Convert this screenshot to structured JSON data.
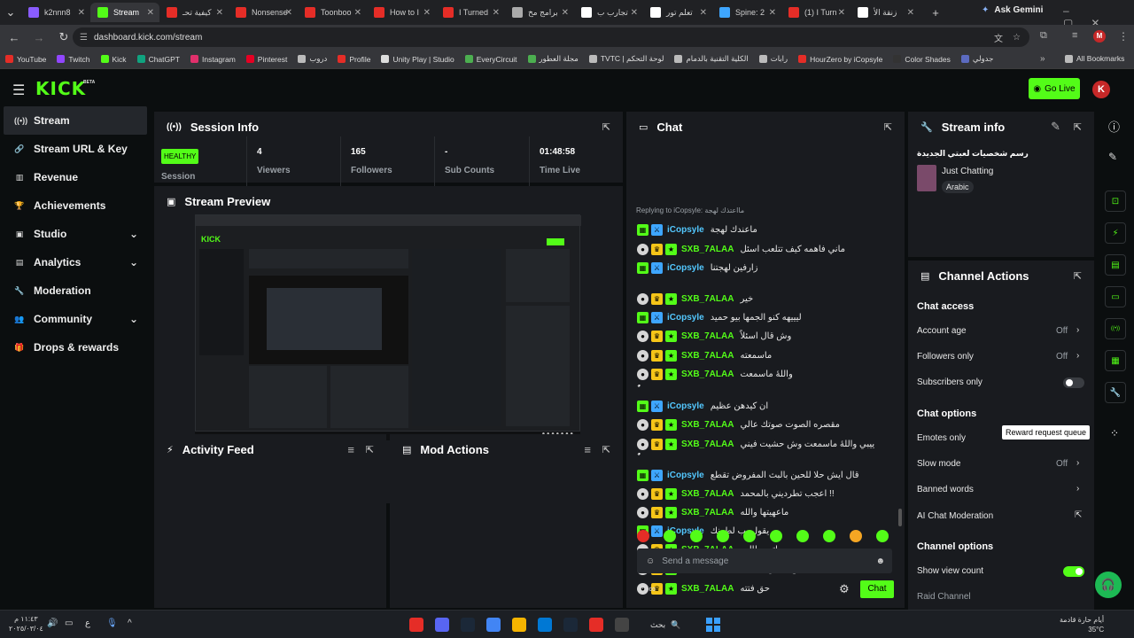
{
  "browser": {
    "tabs": [
      "k2nnn8",
      "Stream",
      "كيفية تحـ",
      "Nonsense",
      "Toonboo",
      "How to I",
      "I Turned",
      "برامج مخ",
      "تجارب ب",
      "تعلم تور",
      "Spine: 2",
      "(1) I Turn",
      "زنقة الأ"
    ],
    "active_tab": 1,
    "ask_gemini": "Ask Gemini",
    "url": "dashboard.kick.com/stream",
    "bookmarks": [
      "YouTube",
      "Twitch",
      "Kick",
      "ChatGPT",
      "Instagram",
      "Pinterest",
      "دروب",
      "Profile",
      "Unity Play | Studio",
      "EveryCircuit",
      "مجلة العطور",
      "TVTC | لوحة التحكم",
      "الكلية التقنية بالدمام",
      "رابات",
      "HourZero by iCopsyle",
      "Color Shades",
      "جدولي"
    ],
    "all_bookmarks": "All Bookmarks"
  },
  "app": {
    "logo": "KICK",
    "logo_badge": "BETA",
    "go_live": "Go Live",
    "avatar_letter": "K"
  },
  "sidebar": [
    {
      "label": "Stream",
      "icon": "stream-icon",
      "glyph": "((•))",
      "chevron": false
    },
    {
      "label": "Stream URL & Key",
      "icon": "link-icon",
      "glyph": "🔗",
      "chevron": false
    },
    {
      "label": "Revenue",
      "icon": "revenue-icon",
      "glyph": "▥",
      "chevron": false
    },
    {
      "label": "Achievements",
      "icon": "trophy-icon",
      "glyph": "🏆",
      "chevron": false
    },
    {
      "label": "Studio",
      "icon": "studio-icon",
      "glyph": "▣",
      "chevron": true
    },
    {
      "label": "Analytics",
      "icon": "analytics-icon",
      "glyph": "▤",
      "chevron": true
    },
    {
      "label": "Moderation",
      "icon": "wrench-icon",
      "glyph": "🔧",
      "chevron": false
    },
    {
      "label": "Community",
      "icon": "community-icon",
      "glyph": "👥",
      "chevron": true
    },
    {
      "label": "Drops & rewards",
      "icon": "gift-icon",
      "glyph": "🎁",
      "chevron": false
    }
  ],
  "session": {
    "title": "Session Info",
    "health": "HEALTHY",
    "health_label": "Session",
    "stats": [
      {
        "value": "4",
        "label": "Viewers"
      },
      {
        "value": "165",
        "label": "Followers"
      },
      {
        "value": "-",
        "label": "Sub Counts"
      },
      {
        "value": "01:48:58",
        "label": "Time Live"
      }
    ]
  },
  "preview": {
    "title": "Stream Preview"
  },
  "activity": {
    "title": "Activity Feed"
  },
  "mod": {
    "title": "Mod Actions"
  },
  "chat": {
    "title": "Chat",
    "replying": "Replying to iCopsyle: مااعتذك لهجة",
    "messages": [
      {
        "user": "iCopsyle",
        "kind": "i",
        "text": "ماعندك لهجة"
      },
      {
        "user": "SXB_7ALAA",
        "kind": "s",
        "text": "ماني فاهمه كيف تتلعب اسئل"
      },
      {
        "user": "iCopsyle",
        "kind": "i",
        "text": "زارفين لهجتنا"
      },
      {
        "user": "SXB_7ALAA",
        "kind": "s",
        "text": "خير"
      },
      {
        "user": "iCopsyle",
        "kind": "i",
        "text": "ليييهه كنو الجمها بيو حميد"
      },
      {
        "user": "SXB_7ALAA",
        "kind": "s",
        "text": "وش قال اسئلاً"
      },
      {
        "user": "SXB_7ALAA",
        "kind": "s",
        "text": "ماسمعته"
      },
      {
        "user": "SXB_7ALAA",
        "kind": "s",
        "text": "واللهٔ ماسمعت"
      },
      {
        "user": "",
        "kind": "",
        "text": "ٌٌٌٌٌٌٌٌٌٌٌٌٌٌٌٌٌٌٌٌٌٌٌٌٌٌٌٌٌٌٌٌٌٌٌٌٌٌٌٌٌٌٌٌٌٌٌٌٌٌٌٌٌٌٌٌٌٌٌٌٌٌٌٌٌٌٌٌٌٌٌٌٌٌٌٌٌٌٌٌٌٌٌٌٌٌٌٌٌٌٌٌٌٌٌٌٌ"
      },
      {
        "user": "iCopsyle",
        "kind": "i",
        "text": "ان كيدهن عظيم"
      },
      {
        "user": "SXB_7ALAA",
        "kind": "s",
        "text": "مقصره الصوت صوتك عالي"
      },
      {
        "user": "SXB_7ALAA",
        "kind": "s",
        "text": "ييبي واللهٔ ماسمعت وش حشيت فيني"
      },
      {
        "user": "",
        "kind": "",
        "text": "ٌٌٌٌٌٌٌٌٌٌٌٌٌٌٌٌٌٌٌٌٌٌٌٌٌٌٌٌٌٌٌٌٌٌٌٌٌٌٌٌٌٌٌٌٌٌٌٌٌٌٌٌٌٌٌٌٌٌٌٌٌٌٌٌٌٌٌٌٌٌٌٌٌٌٌٌٌٌٌٌٌٌٌٌٌٌٌٌٌٌٌٌٌٌٌٌٌ"
      },
      {
        "user": "iCopsyle",
        "kind": "i",
        "text": "قال ايش حلا للحين بالبث المفروض تقطع"
      },
      {
        "user": "SXB_7ALAA",
        "kind": "s",
        "text": "اعجب تطرديني بالمحمد !!"
      },
      {
        "user": "SXB_7ALAA",
        "kind": "s",
        "text": "ماعهيتها والله"
      },
      {
        "user": "iCopsyle",
        "kind": "i",
        "text": "يقول يب لطرنك"
      },
      {
        "user": "SXB_7ALAA",
        "kind": "s",
        "text": "بس ماتب طالعه"
      },
      {
        "user": "SXB_7ALAA",
        "kind": "s",
        "text": "تحس كيسوله كذاب"
      },
      {
        "user": "SXB_7ALAA",
        "kind": "s",
        "text": "حق فتته"
      }
    ],
    "placeholder": "Send a message",
    "send": "Chat",
    "infinity": "∞"
  },
  "stream_info": {
    "title": "Stream info",
    "stream_title": "رسم شخصيات لعبتي الجديدة",
    "category": "Just Chatting",
    "tag": "Arabic"
  },
  "channel_actions": {
    "title": "Channel Actions",
    "chat_access": "Chat access",
    "account_age": "Account age",
    "account_age_val": "Off",
    "followers_only": "Followers only",
    "followers_only_val": "Off",
    "subscribers_only": "Subscribers only",
    "chat_options": "Chat options",
    "emotes_only": "Emotes only",
    "tooltip": "Reward request queue",
    "slow_mode": "Slow mode",
    "slow_mode_val": "Off",
    "banned_words": "Banned words",
    "ai_mod": "AI Chat Moderation",
    "channel_options": "Channel options",
    "show_view_count": "Show view count",
    "raid": "Raid Channel"
  },
  "taskbar": {
    "time": "١١:٤٣ م",
    "date": "٢٠٢٥/٠٣/٠٤",
    "lang": "ع",
    "search": "بحث",
    "weather": "أيام حارة قادمة",
    "temp": "35°C"
  },
  "colors": {
    "kick_green": "#53fc18",
    "panel": "#191b1f",
    "bg": "#0b0e0f"
  }
}
